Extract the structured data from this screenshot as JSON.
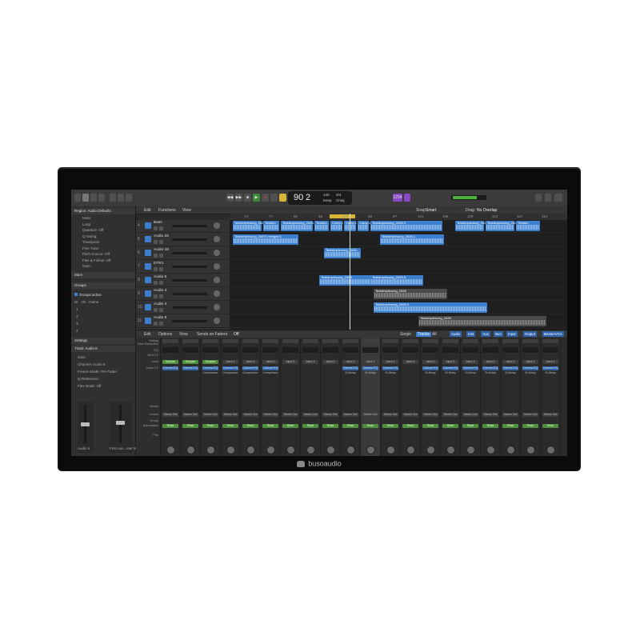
{
  "brand": {
    "name": "busoaudio"
  },
  "toolbar": {
    "tempo": "90",
    "position": "2",
    "bpm_label": "140",
    "keep_label": "Keep",
    "signature": "4/4",
    "key": "Cmaj",
    "badge1": "1234",
    "snap_label": "Snap:",
    "snap_value": "Smart",
    "drag_label": "Drag:",
    "drag_value": "No Overlap"
  },
  "tracks_toolbar": {
    "edit": "Edit",
    "functions": "Functions",
    "view": "View"
  },
  "inspector": {
    "region_title": "Region: Audio Defaults",
    "region_rows": [
      "Mute:",
      "Loop:",
      "Quantize: Off",
      "Q-Swing:",
      "Transpose:",
      "Fine Tune:",
      "Pitch Source: Off",
      "Flex & Follow: Off",
      "Gain:"
    ],
    "more": "More",
    "groups_title": "Groups",
    "groups_active": "Groups active",
    "groups_cols": [
      "Nr",
      "On",
      "Name"
    ],
    "groups_rows": [
      "1",
      "2",
      "3",
      "4"
    ],
    "settings": "Settings",
    "track_title": "Track: Audio 6",
    "track_rows": [
      "Gain:",
      "Channel: Audio 6",
      "Freeze Mode: Pre Fader",
      "Q-Reference:",
      "Flex Mode: Off"
    ],
    "strip_names": [
      "Audio 6",
      "First Aux...ster Wide"
    ]
  },
  "ruler": [
    "73",
    "77",
    "81",
    "85",
    "89",
    "93",
    "97",
    "101",
    "105",
    "109",
    "113",
    "117",
    "121",
    "125"
  ],
  "tracks": [
    {
      "num": "4",
      "name": "Bass"
    },
    {
      "num": "5",
      "name": "Audio 25"
    },
    {
      "num": "6",
      "name": "Audio 28"
    },
    {
      "num": "7",
      "name": "DTR1"
    },
    {
      "num": "8",
      "name": "Audio 5"
    },
    {
      "num": "9",
      "name": "Audio 3"
    },
    {
      "num": "10",
      "name": "Audio 4"
    },
    {
      "num": "11",
      "name": "Audio 8"
    }
  ],
  "regions": [
    {
      "lane": 0,
      "name": "Testsimplesong_2#28.9",
      "gray": false
    },
    {
      "lane": 0,
      "name": "Testsim",
      "gray": false
    },
    {
      "lane": 0,
      "name": "Testsimplesong_2#28.7",
      "gray": false
    },
    {
      "lane": 0,
      "name": "Testsim",
      "gray": false
    },
    {
      "lane": 0,
      "name": "Comp 1",
      "gray": false
    },
    {
      "lane": 0,
      "name": "Comp 1",
      "gray": false
    },
    {
      "lane": 0,
      "name": "Comp 1",
      "gray": false
    },
    {
      "lane": 0,
      "name": "Testsimplesong_2#28.3",
      "gray": false
    },
    {
      "lane": 0,
      "name": "Testsimplesong_2#28.8",
      "gray": false
    },
    {
      "lane": 0,
      "name": "Testsimplesong_2#28.8",
      "gray": false
    },
    {
      "lane": 0,
      "name": "Testsim",
      "gray": false
    },
    {
      "lane": 1,
      "name": "Testsimplesong_2#871 merged 1",
      "gray": false
    },
    {
      "lane": 1,
      "name": "Testsimplesong_2#28.1",
      "gray": false
    },
    {
      "lane": 2,
      "name": "Testsimplesong_2#28",
      "gray": false
    },
    {
      "lane": 4,
      "name": "Testsimplesong_2#28",
      "gray": false
    },
    {
      "lane": 4,
      "name": "Testsimplesong_2#28.5",
      "gray": false
    },
    {
      "lane": 5,
      "name": "Testsimplesong_2#28",
      "gray": true
    },
    {
      "lane": 6,
      "name": "Testsimplesong_2#28.4",
      "gray": false
    },
    {
      "lane": 7,
      "name": "Testsimplesong_2#28",
      "gray": true
    }
  ],
  "mixer_toolbar": {
    "edit": "Edit",
    "options": "Options",
    "view": "View",
    "sends": "Sends on Faders:",
    "sends_val": "Off",
    "single": "Single",
    "tracks": "Tracks",
    "all": "All",
    "filters": [
      "Audio",
      "Inst",
      "Aux",
      "Bus",
      "Input",
      "Output",
      "Master/VCA",
      "MIDI"
    ]
  },
  "mixer_labels": [
    "Setting",
    "Gain Reduction",
    "EQ",
    "MIDI FX",
    "Input",
    "Audio FX",
    "Sends",
    "Output",
    "Group",
    "Automation",
    "Pan"
  ],
  "channels": [
    {
      "input": "Sampler",
      "fx": "Channel EQ",
      "fx2": "",
      "out": "Stereo Out",
      "auto": "Read",
      "inst": true
    },
    {
      "input": "Sampler",
      "fx": "Channel EQ",
      "fx2": "",
      "out": "Stereo Out",
      "auto": "Read",
      "inst": true
    },
    {
      "input": "Sampler",
      "fx": "Channel EQ",
      "fx2": "Compressor",
      "out": "Stereo Out",
      "auto": "Read",
      "inst": true
    },
    {
      "input": "Input 3",
      "fx": "Channel EQ",
      "fx2": "Compressor",
      "out": "Stereo Out",
      "auto": "Read",
      "inst": false
    },
    {
      "input": "Input 3",
      "fx": "Channel EQ",
      "fx2": "Compressor",
      "out": "Stereo Out",
      "auto": "Read",
      "inst": false
    },
    {
      "input": "Input 3",
      "fx": "Channel EQ",
      "fx2": "Compressor",
      "out": "Stereo Out",
      "auto": "Read",
      "inst": false
    },
    {
      "input": "Input 3",
      "fx": "",
      "fx2": "",
      "out": "Stereo Out",
      "auto": "Read",
      "inst": false
    },
    {
      "input": "Input 3",
      "fx": "",
      "fx2": "",
      "out": "Stereo Out",
      "auto": "Read",
      "inst": false
    },
    {
      "input": "Input 3",
      "fx": "",
      "fx2": "",
      "out": "Stereo Out",
      "auto": "Read",
      "inst": false
    },
    {
      "input": "Input 3",
      "fx": "Channel EQ",
      "fx2": "St-Delay",
      "out": "Stereo Out",
      "auto": "Read",
      "inst": false
    },
    {
      "input": "Input 3",
      "fx": "Channel EQ",
      "fx2": "St-Delay",
      "out": "Stereo Out",
      "auto": "Read",
      "inst": false
    },
    {
      "input": "Input 3",
      "fx": "Channel EQ",
      "fx2": "St-Delay",
      "out": "Stereo Out",
      "auto": "Read",
      "inst": false
    },
    {
      "input": "Input 3",
      "fx": "",
      "fx2": "",
      "out": "Stereo Out",
      "auto": "Read",
      "inst": false
    },
    {
      "input": "Input 3",
      "fx": "Channel EQ",
      "fx2": "St-Delay",
      "out": "Stereo Out",
      "auto": "Read",
      "inst": false
    },
    {
      "input": "Input 3",
      "fx": "Channel EQ",
      "fx2": "St-Delay",
      "out": "Stereo Out",
      "auto": "Read",
      "inst": false
    },
    {
      "input": "Input 3",
      "fx": "Channel EQ",
      "fx2": "St-Delay",
      "out": "Stereo Out",
      "auto": "Read",
      "inst": false
    },
    {
      "input": "Input 3",
      "fx": "Channel EQ",
      "fx2": "St-Delay",
      "out": "Stereo Out",
      "auto": "Read",
      "inst": false
    },
    {
      "input": "Input 3",
      "fx": "Channel EQ",
      "fx2": "St-Delay",
      "out": "Stereo Out",
      "auto": "Read",
      "inst": false
    },
    {
      "input": "Input 3",
      "fx": "Channel EQ",
      "fx2": "St-Delay",
      "out": "Stereo Out",
      "auto": "Read",
      "inst": false
    },
    {
      "input": "Input 3",
      "fx": "Channel EQ",
      "fx2": "St-Delay",
      "out": "Stereo Out",
      "auto": "Read",
      "inst": false
    }
  ],
  "colors": {
    "region": "#3c7fcf",
    "accent_green": "#4f8f3e",
    "cycle_yellow": "#d8b437",
    "frame": "#0b0b0c"
  }
}
